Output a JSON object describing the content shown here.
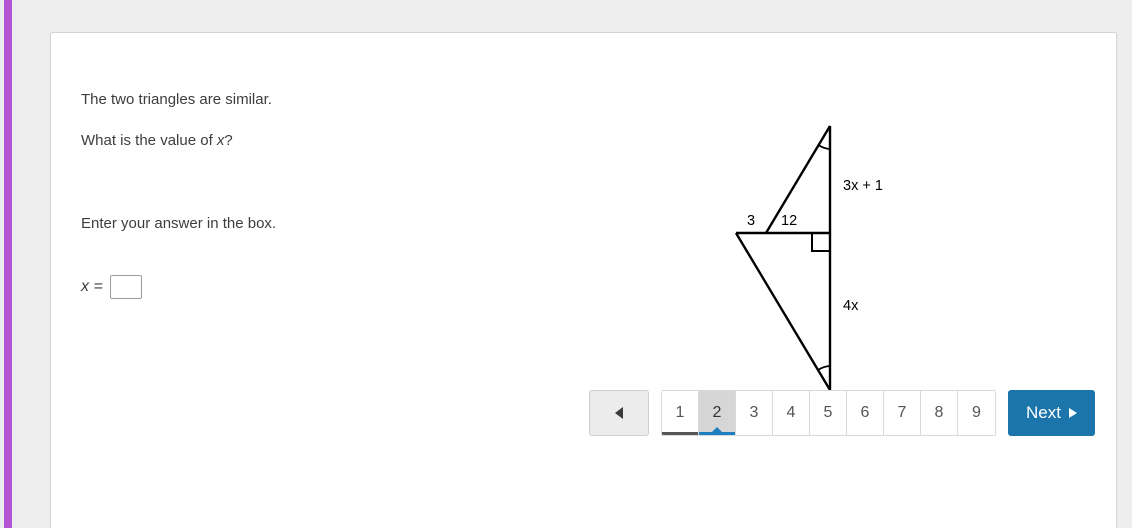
{
  "theme": {
    "page_background": "#ededed",
    "card_background": "#ffffff",
    "rail_color": "#b254d4",
    "accent_blue": "#1b75ab",
    "active_page_bg": "#d6d6d6",
    "text_color": "#3d3d3d"
  },
  "question": {
    "statement": "The two triangles are similar.",
    "prompt_prefix": "What is the value of ",
    "prompt_variable": "x",
    "prompt_suffix": "?",
    "instruction": "Enter your answer in the box.",
    "answer_label": "x =",
    "answer_value": "",
    "answer_placeholder": ""
  },
  "figure": {
    "type": "two-similar-right-triangles",
    "labels": {
      "top_side": "3x + 1",
      "top_side_coefficient": "3x",
      "top_side_operator": "+",
      "top_side_constant": "1",
      "bottom_side": "4x",
      "upper_base_left": "3",
      "upper_base_right": "12"
    },
    "markers": {
      "right_angle": "right-angle-square",
      "top_angle_arc": "single-arc",
      "bottom_angle_arc": "single-arc"
    }
  },
  "pagination": {
    "prev_label": "◄",
    "pages": [
      {
        "label": "1",
        "state": "visited"
      },
      {
        "label": "2",
        "state": "current"
      },
      {
        "label": "3",
        "state": "default"
      },
      {
        "label": "4",
        "state": "default"
      },
      {
        "label": "5",
        "state": "default"
      },
      {
        "label": "6",
        "state": "default"
      },
      {
        "label": "7",
        "state": "default"
      },
      {
        "label": "8",
        "state": "default"
      },
      {
        "label": "9",
        "state": "default"
      }
    ],
    "next_label": "Next",
    "current_page": "2",
    "total_pages": "9"
  }
}
